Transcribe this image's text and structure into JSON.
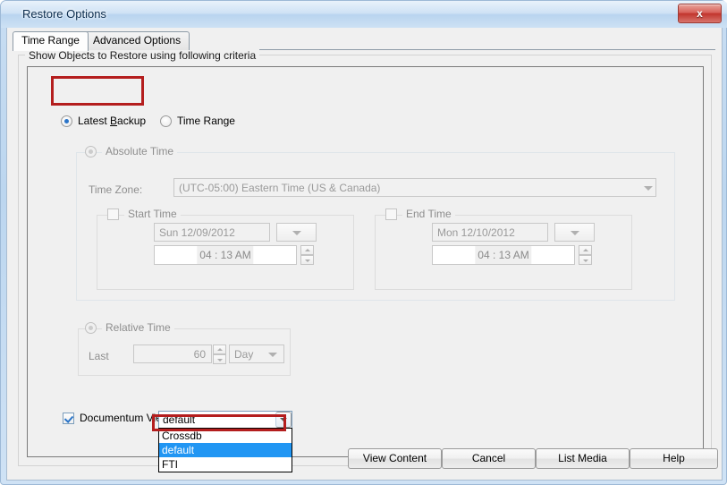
{
  "window": {
    "title": "Restore Options",
    "close_label": "x"
  },
  "tabs": [
    {
      "label": "Time Range",
      "selected": true
    },
    {
      "label": "Advanced Options",
      "selected": false
    }
  ],
  "criteria_group": {
    "legend": "Show Objects to Restore using following criteria"
  },
  "mode": {
    "latest_backup_label": "Latest Backup",
    "latest_backup_accel": "B",
    "time_range_label": "Time Range",
    "selected": "Latest Backup"
  },
  "absolute_time": {
    "legend": "Absolute Time",
    "enabled": false,
    "time_zone_label": "Time Zone:",
    "time_zone_value": "(UTC-05:00) Eastern Time (US & Canada)",
    "start_time": {
      "legend": "Start Time",
      "checked": false,
      "date": "Sun 12/09/2012",
      "time_hour": "04",
      "time_sep": ":",
      "time_rest": "13 AM"
    },
    "end_time": {
      "legend": "End Time",
      "checked": false,
      "date": "Mon 12/10/2012",
      "time_hour": "04",
      "time_sep": ":",
      "time_rest": "13 AM"
    }
  },
  "relative_time": {
    "legend": "Relative Time",
    "enabled": false,
    "last_label": "Last",
    "amount": "60",
    "unit": "Day"
  },
  "documentum_view": {
    "checkbox_label": "Documentum View",
    "checked": true,
    "selected_value": "default",
    "options": [
      "Crossdb",
      "default",
      "FTI"
    ],
    "highlighted_option": "default"
  },
  "buttons": {
    "view_content": "View Content",
    "cancel": "Cancel",
    "list_media": "List Media",
    "help": "Help"
  },
  "colors": {
    "annotation_red": "#b41e1e",
    "selection_blue": "#2196f3",
    "title_blue": "#0b2c4d"
  }
}
